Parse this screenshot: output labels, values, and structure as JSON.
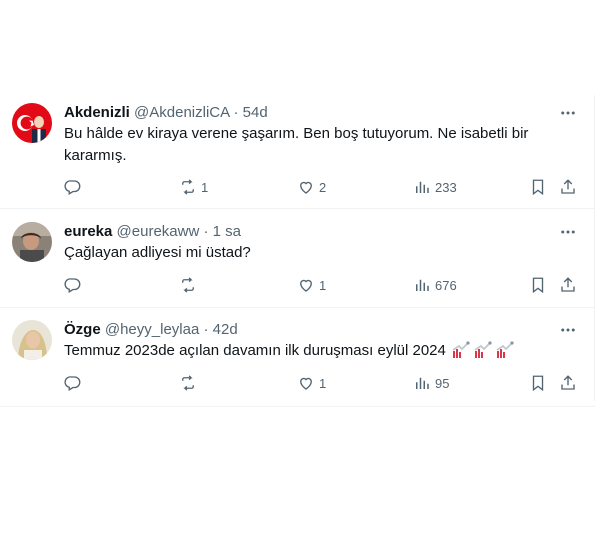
{
  "tweets": [
    {
      "name": "Akdenizli",
      "handle": "@AkdenizliCA",
      "dot": "·",
      "time": "54d",
      "text": "Bu hâlde ev kiraya verene şaşarım. Ben boş tutuyorum. Ne isabetli bir kararmış.",
      "replies": "",
      "reposts": "1",
      "likes": "2",
      "views": "233",
      "avatar": "flag-avatar"
    },
    {
      "name": "eureka",
      "handle": "@eurekaww",
      "dot": "·",
      "time": "1 sa",
      "text": "Çağlayan adliyesi mi üstad?",
      "replies": "",
      "reposts": "",
      "likes": "1",
      "views": "676",
      "avatar": "photo-avatar"
    },
    {
      "name": "Özge",
      "handle": "@heyy_leylaa",
      "dot": "·",
      "time": "42d",
      "text": "Temmuz 2023de açılan davamın ilk duruşması eylül 2024",
      "emoji": [
        "chart-increasing",
        "chart-increasing",
        "chart-increasing"
      ],
      "replies": "",
      "reposts": "",
      "likes": "1",
      "views": "95",
      "avatar": "photo-avatar"
    }
  ],
  "colors": {
    "text": "#0f1419",
    "secondary": "#536471",
    "divider": "#eff3f4",
    "flag_red": "#e30a17"
  }
}
